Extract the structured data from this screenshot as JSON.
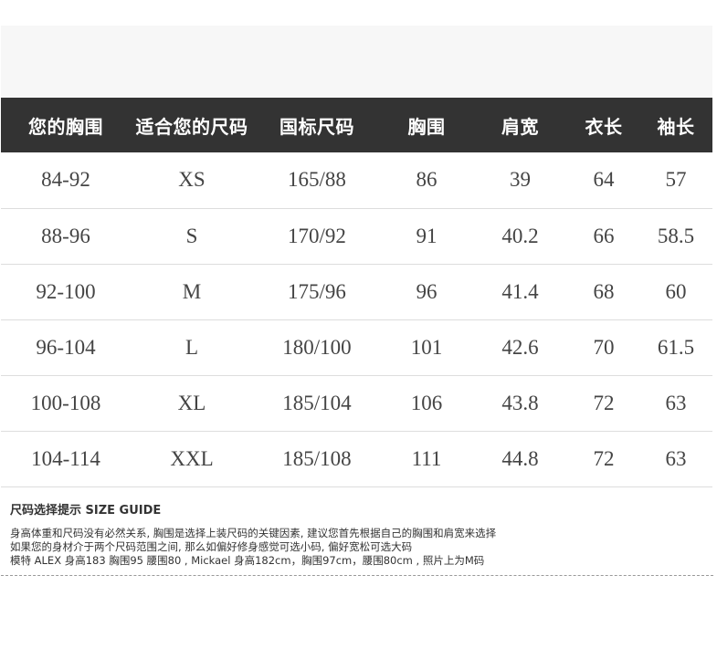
{
  "table": {
    "headers": [
      "您的胸围",
      "适合您的尺码",
      "国标尺码",
      "胸围",
      "肩宽",
      "衣长",
      "袖长"
    ],
    "rows": [
      [
        "84-92",
        "XS",
        "165/88",
        "86",
        "39",
        "64",
        "57"
      ],
      [
        "88-96",
        "S",
        "170/92",
        "91",
        "40.2",
        "66",
        "58.5"
      ],
      [
        "92-100",
        "M",
        "175/96",
        "96",
        "41.4",
        "68",
        "60"
      ],
      [
        "96-104",
        "L",
        "180/100",
        "101",
        "42.6",
        "70",
        "61.5"
      ],
      [
        "100-108",
        "XL",
        "185/104",
        "106",
        "43.8",
        "72",
        "63"
      ],
      [
        "104-114",
        "XXL",
        "185/108",
        "111",
        "44.8",
        "72",
        "63"
      ]
    ]
  },
  "guide": {
    "title": "尺码选择提示 SIZE GUIDE",
    "lines": [
      "身高体重和尺码没有必然关系, 胸围是选择上装尺码的关键因素, 建议您首先根据自己的胸围和肩宽来选择",
      "如果您的身材介于两个尺码范围之间, 那么如偏好修身感觉可选小码, 偏好宽松可选大码",
      "模特 ALEX 身高183 胸围95 腰围80 , Mickael 身高182cm，胸围97cm，腰围80cm , 照片上为M码"
    ]
  },
  "colors": {
    "header_bg": "#333333",
    "header_text": "#ffffff",
    "cell_text": "#444444",
    "row_divider": "#dddddd",
    "top_band": "#f7f7f7"
  }
}
